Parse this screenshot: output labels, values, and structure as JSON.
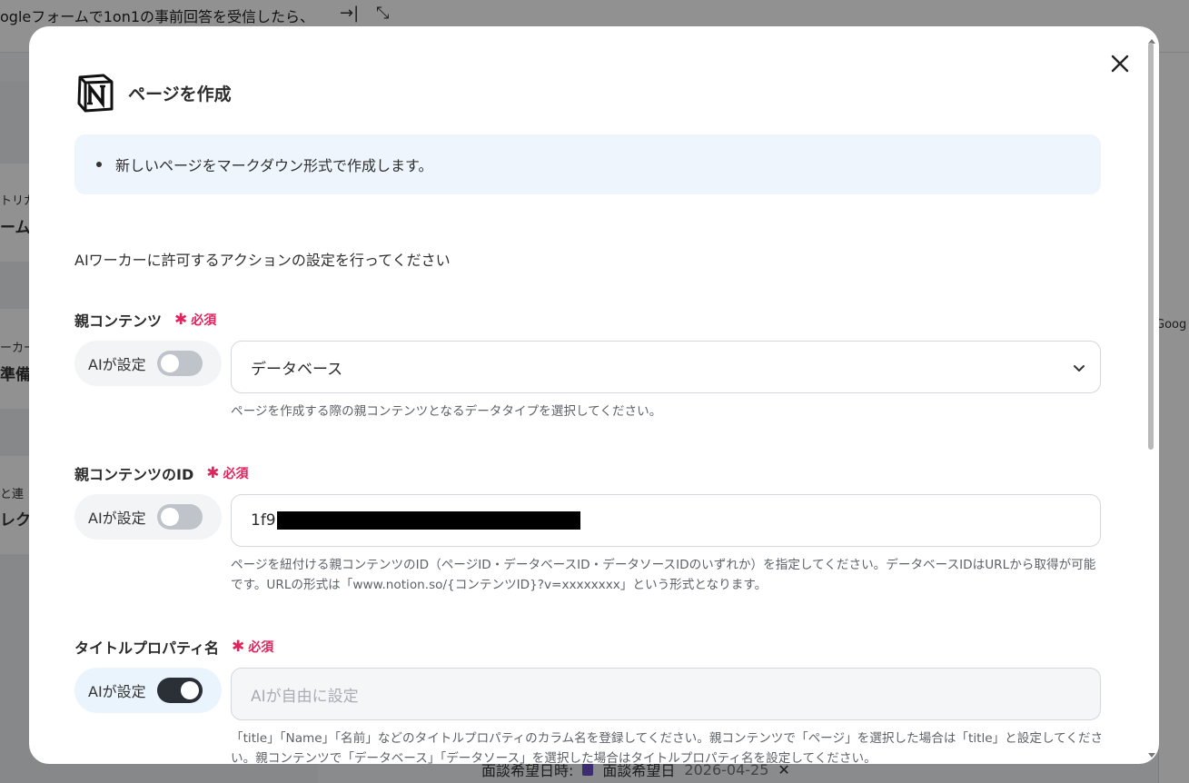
{
  "background": {
    "workflow_title": "ogleフォームで1on1の事前回答を受信したら、",
    "snippets": [
      "トリガ",
      "ーム",
      "ーカー",
      "準備",
      "と連",
      "レク",
      "Goog"
    ],
    "bottom_row": {
      "label": "面談希望日時:",
      "chip_label": "面談希望日",
      "chip_value": "2026-04-25"
    }
  },
  "modal": {
    "title": "ページを作成",
    "info_bullets": [
      "新しいページをマークダウン形式で作成します。"
    ],
    "intro": "AIワーカーに許可するアクションの設定を行ってください",
    "required_label": "必須",
    "ai_toggle_label": "AIが設定",
    "fields": [
      {
        "label": "親コンテンツ",
        "ai_enabled": false,
        "value": "データベース",
        "help": "ページを作成する際の親コンテンツとなるデータタイプを選択してください。"
      },
      {
        "label": "親コンテンツのID",
        "ai_enabled": false,
        "value": "1f9",
        "help": "ページを紐付ける親コンテンツのID（ページID・データベースID・データソースIDのいずれか）を指定してください。データベースIDはURLから取得が可能です。URLの形式は「www.notion.so/{コンテンツID}?v=xxxxxxxx」という形式となります。"
      },
      {
        "label": "タイトルプロパティ名",
        "ai_enabled": true,
        "placeholder": "AIが自由に設定",
        "help": "「title」「Name」「名前」などのタイトルプロパティのカラム名を登録してください。親コンテンツで「ページ」を選択した場合は「title」と設定してください。親コンテンツで「データベース」「データソース」を選択した場合はタイトルプロパティ名を設定してください。"
      }
    ]
  },
  "icons": [
    "notion-logo-icon",
    "close-icon",
    "chevron-down-icon",
    "collapse-right-icon",
    "expand-icon"
  ]
}
